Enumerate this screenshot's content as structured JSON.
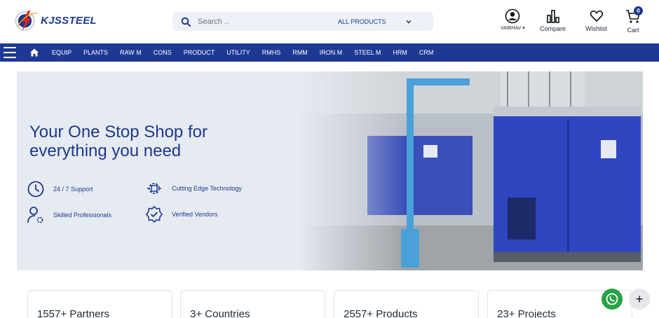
{
  "header": {
    "logo_text": "KJSSTEEL",
    "search": {
      "placeholder": "Search ..",
      "category": "ALL PRODUCTS"
    },
    "account_label": "VAIBHAV",
    "compare_label": "Compare",
    "wishlist_label": "Wishlist",
    "cart_label": "Cart",
    "cart_count": "0"
  },
  "nav": {
    "items": [
      "EQUIP",
      "PLANTS",
      "RAW M",
      "CONS",
      "PRODUCT",
      "UTILITY",
      "RMHS",
      "RMM",
      "IRON M",
      "STEEL M",
      "HRM",
      "CRM"
    ]
  },
  "hero": {
    "title_line1": "Your One Stop Shop for",
    "title_line2": "everything you need",
    "features": [
      {
        "label": "24 / 7 Support",
        "icon": "clock-icon"
      },
      {
        "label": "Cutting Edge Technology",
        "icon": "chip-gear-icon"
      },
      {
        "label": "Skilled Professionals",
        "icon": "user-gear-icon"
      },
      {
        "label": "Verified Vendors",
        "icon": "verified-badge-icon"
      }
    ]
  },
  "stats": [
    "1557+ Partners",
    "3+ Countries",
    "2557+ Products",
    "23+ Projects"
  ],
  "colors": {
    "brand": "#1d3994",
    "accent_red": "#d9261c",
    "whatsapp": "#25a244"
  }
}
